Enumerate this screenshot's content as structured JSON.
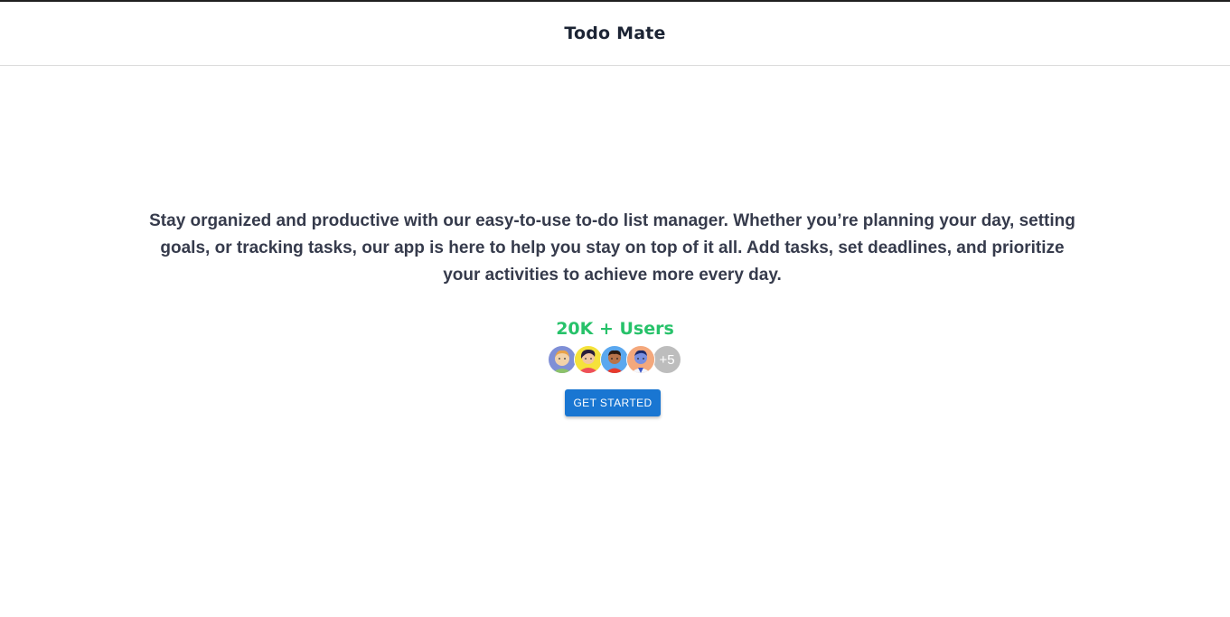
{
  "header": {
    "title": "Todo Mate"
  },
  "hero": {
    "tagline": "Stay organized and productive with our easy-to-use to-do list manager. Whether you’re planning your day, setting goals, or tracking tasks, our app is here to help you stay on top of it all. Add tasks, set deadlines, and prioritize your activities to achieve more every day.",
    "users_count": "20K + Users",
    "avatars": [
      {
        "icon": "user-avatar-icon",
        "bg": "#7f8fd6"
      },
      {
        "icon": "user-avatar-icon",
        "bg": "#f5e23a"
      },
      {
        "icon": "user-avatar-icon",
        "bg": "#5aa8ef"
      },
      {
        "icon": "user-avatar-icon",
        "bg": "#f4a87c"
      }
    ],
    "more_users": "+5",
    "cta_label": "GET STARTED"
  },
  "colors": {
    "accent": "#1976d2",
    "users_green": "#27c26a",
    "text": "#363b4c"
  }
}
